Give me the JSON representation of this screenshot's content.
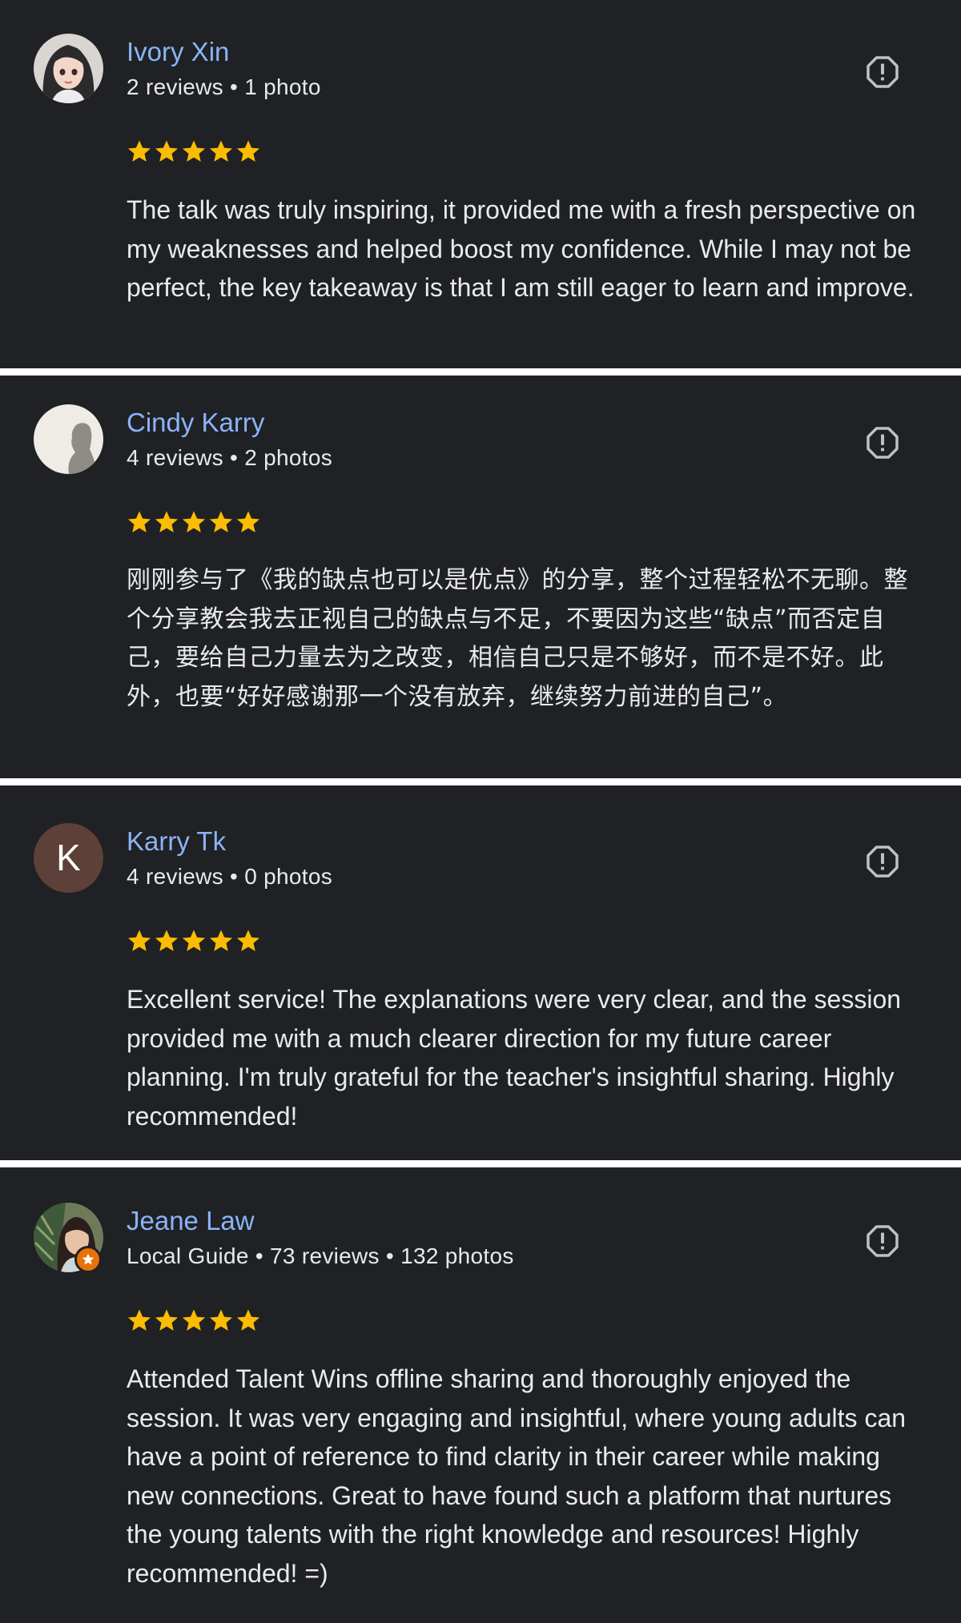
{
  "reviews": [
    {
      "name": "Ivory Xin",
      "meta": "2 reviews • 1 photo",
      "rating": 5,
      "avatar": "cartoon-girl-avatar",
      "text": "The talk was truly inspiring, it provided me with a fresh perspective on my weaknesses and helped boost my confidence. While I may not be perfect, the key takeaway is that I am still eager to learn and improve."
    },
    {
      "name": "Cindy Karry",
      "meta": "4 reviews • 2 photos",
      "rating": 5,
      "avatar": "silhouette-avatar",
      "text": "刚刚参与了《我的缺点也可以是优点》的分享，整个过程轻松不无聊。整个分享教会我去正视自己的缺点与不足，不要因为这些“缺点”而否定自己，要给自己力量去为之改变，相信自己只是不够好，而不是不好。此外，也要“好好感谢那一个没有放弃，继续努力前进的自己”。"
    },
    {
      "name": "Karry Tk",
      "meta": "4 reviews • 0 photos",
      "rating": 5,
      "avatar_letter": "K",
      "text": "Excellent service! The explanations were very clear, and the session provided me with a much clearer direction for my future career planning. I'm truly grateful for the teacher's insightful sharing. Highly recommended!"
    },
    {
      "name": "Jeane Law",
      "meta": "Local Guide • 73 reviews • 132 photos",
      "rating": 5,
      "avatar": "photo-avatar",
      "local_guide_badge": true,
      "text": "Attended Talent Wins offline sharing and thoroughly enjoyed the session. It was very engaging and insightful, where young adults can have a point of reference to find clarity in their career while making new connections. Great to have found such a platform that nurtures the young talents with the right knowledge and resources! Highly recommended! =)"
    }
  ],
  "colors": {
    "background": "#202124",
    "separator": "#ffffff",
    "name": "#8ab4f8",
    "text": "#e8eaed",
    "star": "#fbbc04",
    "flag_icon": "#bdc1c6",
    "letter_avatar": "#5d4037",
    "local_guide_badge": "#e8710a"
  },
  "icons": {
    "flag": "report-flag-icon",
    "star": "star-icon"
  }
}
